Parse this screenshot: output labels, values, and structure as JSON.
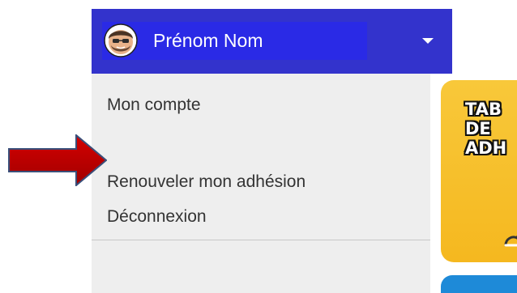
{
  "user_menu": {
    "name": "Prénom Nom",
    "avatar_icon": "cartoon-face-avatar",
    "caret_icon": "caret-down-icon"
  },
  "dropdown": {
    "items": [
      {
        "label": "Mon compte"
      },
      {
        "label": "Renouveler mon adhésion"
      },
      {
        "label": "Déconnexion"
      }
    ]
  },
  "annotation": {
    "arrow_icon": "red-arrow-right-icon",
    "color": "#c00000"
  },
  "promo": {
    "lines": [
      "TAB",
      "DE ",
      "ADH"
    ]
  },
  "colors": {
    "header_bg": "#3333cc",
    "name_highlight": "#2a2ae6",
    "dropdown_bg": "#eeeeee",
    "promo_bg": "#f5b81f",
    "blue_card": "#1e8ad8"
  }
}
